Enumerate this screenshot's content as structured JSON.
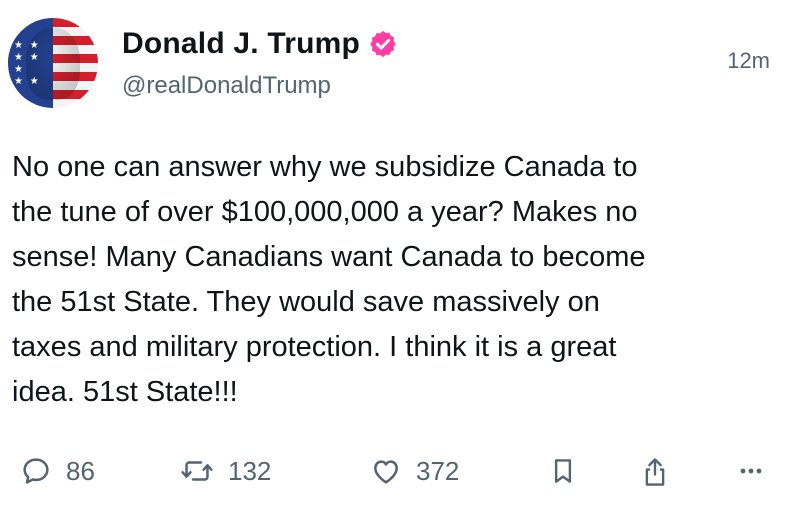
{
  "post": {
    "author_name": "Donald J. Trump",
    "handle": "@realDonaldTrump",
    "time": "12m",
    "text": "No one can answer why we subsidize Canada to\nthe tune of over $100,000,000 a year? Makes no\nsense! Many Canadians want Canada to become\nthe 51st State. They would save massively on\ntaxes and military protection. I think it is a great\nidea. 51st State!!!",
    "avatar_icon": "american-flag-portrait",
    "verified_icon": "verified-badge-icon",
    "verified_color": "#ff3ea5"
  },
  "actions": {
    "replies": "86",
    "reposts": "132",
    "likes": "372",
    "icons": [
      "reply-icon",
      "repost-icon",
      "like-icon",
      "bookmark-icon",
      "share-icon",
      "more-icon"
    ]
  }
}
